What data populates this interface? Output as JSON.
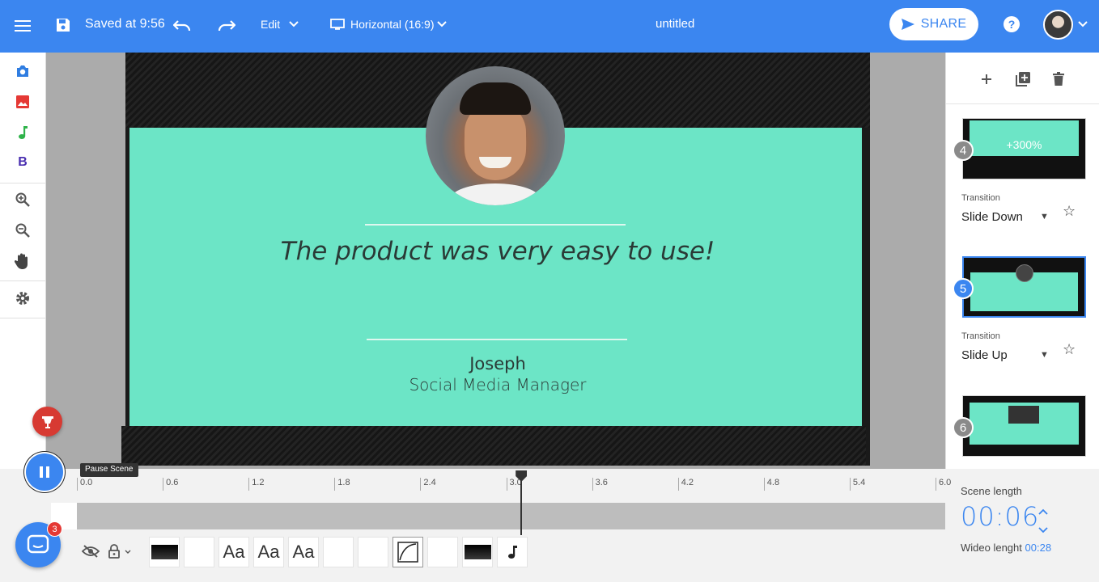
{
  "header": {
    "menu_icon": "menu-icon",
    "save_icon": "floppy-disk-icon",
    "saved_text": "Saved at 9:56",
    "undo_icon": "undo-icon",
    "redo_icon": "redo-icon",
    "edit_label": "Edit",
    "format_label": "Horizontal (16:9)",
    "title": "untitled",
    "share_label": "SHARE",
    "help_label": "?",
    "accent_color": "#3b86f0"
  },
  "left_tools": [
    "camera-icon",
    "image-icon",
    "music-note-icon",
    "bold-text-icon",
    "zoom-in-icon",
    "zoom-out-icon",
    "hand-pan-icon",
    "gear-icon"
  ],
  "slide": {
    "quote": "The product was very easy to use!",
    "name": "Joseph",
    "role": "Social Media Manager",
    "bg_color": "#6ce5c6"
  },
  "scenes": [
    {
      "number": "4",
      "thumb_big": "+300%",
      "transition_label": "Transition",
      "transition": "Slide Down"
    },
    {
      "number": "5",
      "transition_label": "Transition",
      "transition": "Slide Up",
      "selected": true
    },
    {
      "number": "6"
    }
  ],
  "timeline": {
    "ticks": [
      "0.0",
      "0.6",
      "1.2",
      "1.8",
      "2.4",
      "3.0",
      "3.6",
      "4.2",
      "4.8",
      "5.4",
      "6.0"
    ],
    "playhead_value": 3.1,
    "scene_length_label": "Scene length",
    "scene_length": "00:06",
    "wideo_length_label": "Wideo lenght",
    "wideo_length": "00:28",
    "tooltip": "Pause Scene",
    "tracks": [
      "black",
      "white",
      "Aa",
      "Aa",
      "Aa",
      "white",
      "white",
      "curve",
      "white",
      "black",
      "music"
    ]
  },
  "chat_count": "3"
}
